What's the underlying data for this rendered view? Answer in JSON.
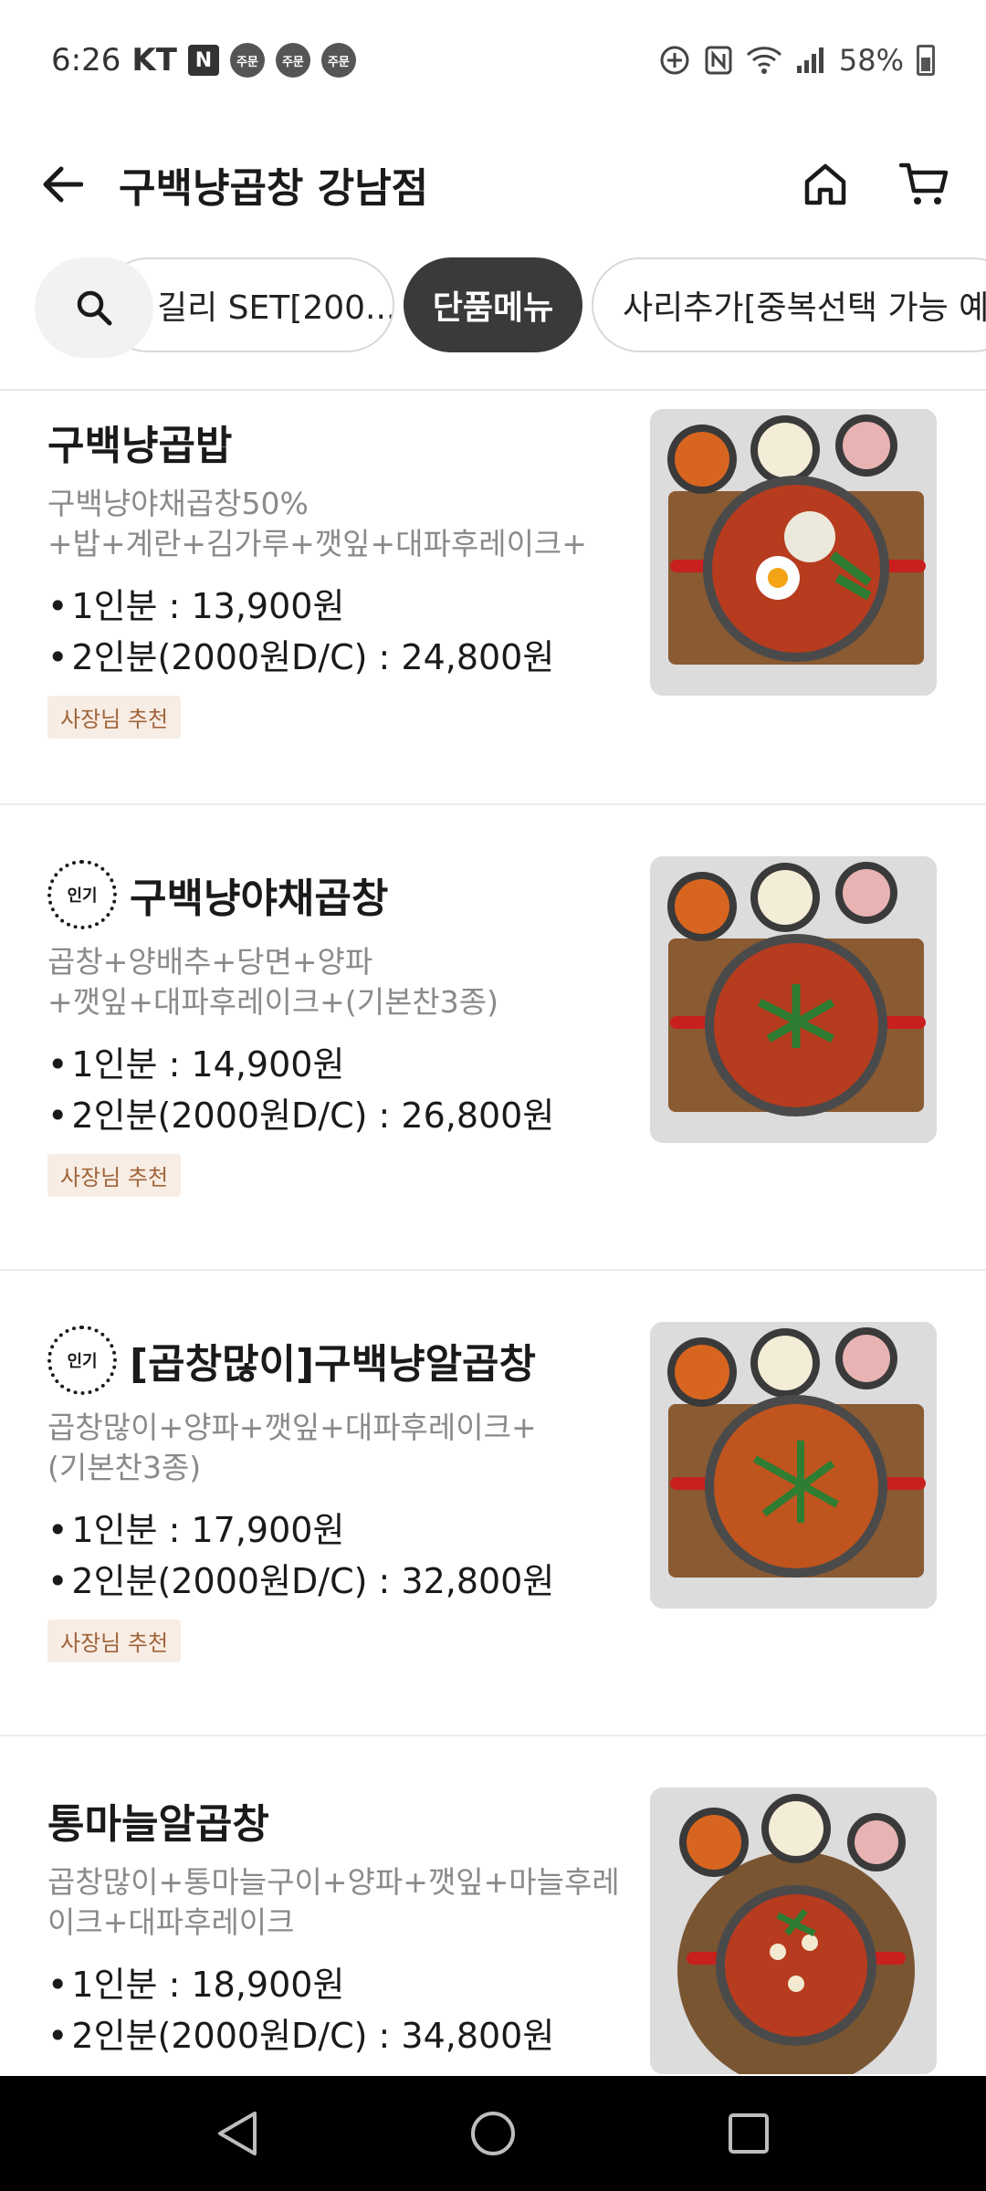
{
  "status_bar": {
    "time": "6:26",
    "carrier": "KT",
    "n_label": "N",
    "order_badges": [
      "주문",
      "주문",
      "주문"
    ],
    "battery": "58%"
  },
  "header": {
    "title": "구백냥곱창 강남점"
  },
  "tabs": [
    {
      "label": "길리 SET[200...",
      "selected": false
    },
    {
      "label": "단품메뉴",
      "selected": true
    },
    {
      "label": "사리추가[중복선택 가능 예...",
      "selected": false
    }
  ],
  "menu_items": [
    {
      "title": "구백냥곱밥",
      "popular": false,
      "desc_lines": [
        "구백냥야채곱창50%",
        "+밥+계란+김가루+깻잎+대파후레이크+(기..."
      ],
      "prices": [
        "1인분 : 13,900원",
        "2인분(2000원D/C) : 24,800원"
      ],
      "badge": "사장님 추천"
    },
    {
      "title": "구백냥야채곱창",
      "popular": true,
      "popular_label": "인기",
      "desc_lines": [
        "곱창+양배추+당면+양파",
        "+깻잎+대파후레이크+(기본찬3종)"
      ],
      "prices": [
        "1인분 : 14,900원",
        "2인분(2000원D/C) : 26,800원"
      ],
      "badge": "사장님 추천"
    },
    {
      "title": "[곱창많이]구백냥알곱창",
      "popular": true,
      "popular_label": "인기",
      "desc_lines": [
        "곱창많이+양파+깻잎+대파후레이크+",
        "(기본찬3종)"
      ],
      "prices": [
        "1인분 : 17,900원",
        "2인분(2000원D/C) : 32,800원"
      ],
      "badge": "사장님 추천"
    },
    {
      "title": "통마늘알곱창",
      "popular": false,
      "desc_lines": [
        "곱창많이+통마늘구이+양파+깻잎+마늘후레",
        "이크+대파후레이크"
      ],
      "prices": [
        "1인분 : 18,900원",
        "2인분(2000원D/C) : 34,800원"
      ],
      "badge": ""
    }
  ],
  "colors": {
    "accent_dark": "#3a3a3a",
    "badge_bg": "#f8ede4",
    "badge_text": "#a0643a",
    "desc_gray": "#8a8a8a"
  }
}
